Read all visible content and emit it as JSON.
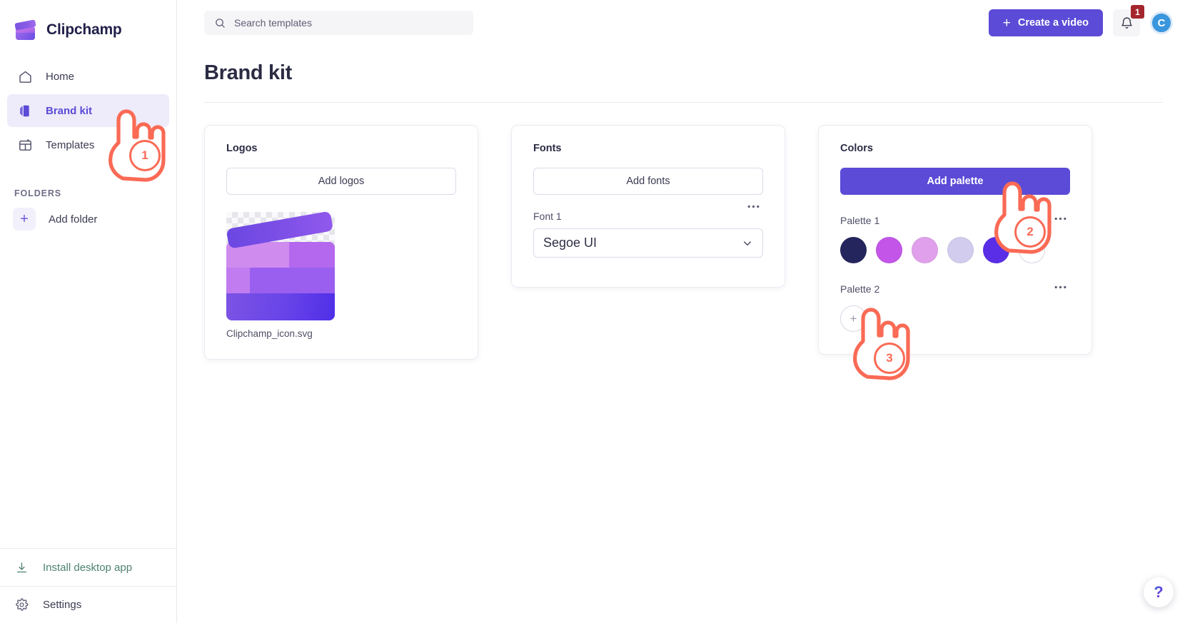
{
  "brand": {
    "name": "Clipchamp",
    "logo_icon": "clipchamp-clapperboard-icon"
  },
  "sidebar": {
    "items": [
      {
        "label": "Home",
        "icon": "home-icon",
        "active": false
      },
      {
        "label": "Brand kit",
        "icon": "brand-kit-icon",
        "active": true
      },
      {
        "label": "Templates",
        "icon": "templates-icon",
        "active": false
      }
    ],
    "folders_heading": "FOLDERS",
    "add_folder": {
      "label": "Add folder",
      "icon": "plus-icon"
    },
    "bottom": [
      {
        "label": "Install desktop app",
        "icon": "download-icon",
        "color": "#4d8172"
      },
      {
        "label": "Settings",
        "icon": "gear-icon",
        "color": "#3b3b52"
      }
    ]
  },
  "topbar": {
    "search": {
      "placeholder": "Search templates",
      "value": "",
      "icon": "search-icon"
    },
    "create_button": {
      "label": "Create a video",
      "icon": "plus-icon"
    },
    "notifications": {
      "icon": "bell-icon",
      "count": "1"
    },
    "avatar": {
      "initial": "C"
    }
  },
  "page": {
    "title": "Brand kit"
  },
  "cards": {
    "logos": {
      "title": "Logos",
      "add_button": "Add logos",
      "items": [
        {
          "name": "Clipchamp_icon.svg",
          "icon": "logo-thumbnail"
        }
      ]
    },
    "fonts": {
      "title": "Fonts",
      "add_button": "Add fonts",
      "font_label": "Font 1",
      "font_value": "Segoe UI",
      "more_icon": "ellipsis-icon",
      "chevron_icon": "chevron-down-icon"
    },
    "colors": {
      "title": "Colors",
      "add_button": "Add palette",
      "more_icon": "ellipsis-icon",
      "palettes": [
        {
          "label": "Palette 1",
          "swatches": [
            "#25255e",
            "#c356e8",
            "#e1a0ec",
            "#d2cdee",
            "#5a2ee6"
          ],
          "add_swatch_icon": "plus-icon"
        },
        {
          "label": "Palette 2",
          "swatches": [],
          "add_swatch_icon": "plus-icon"
        }
      ]
    }
  },
  "help": {
    "label": "?",
    "icon": "question-mark-icon"
  },
  "annotations": {
    "accent_color": "#fa6a55",
    "steps": [
      {
        "number": "1",
        "target": "sidebar-item-brand-kit"
      },
      {
        "number": "2",
        "target": "add-palette-button"
      },
      {
        "number": "3",
        "target": "palette-2-add-swatch"
      }
    ]
  },
  "colors": {
    "primary": "#5b4bd6",
    "sidebar_active_bg": "#eeebfb",
    "badge": "#a4262c",
    "avatar": "#3a96dd"
  }
}
